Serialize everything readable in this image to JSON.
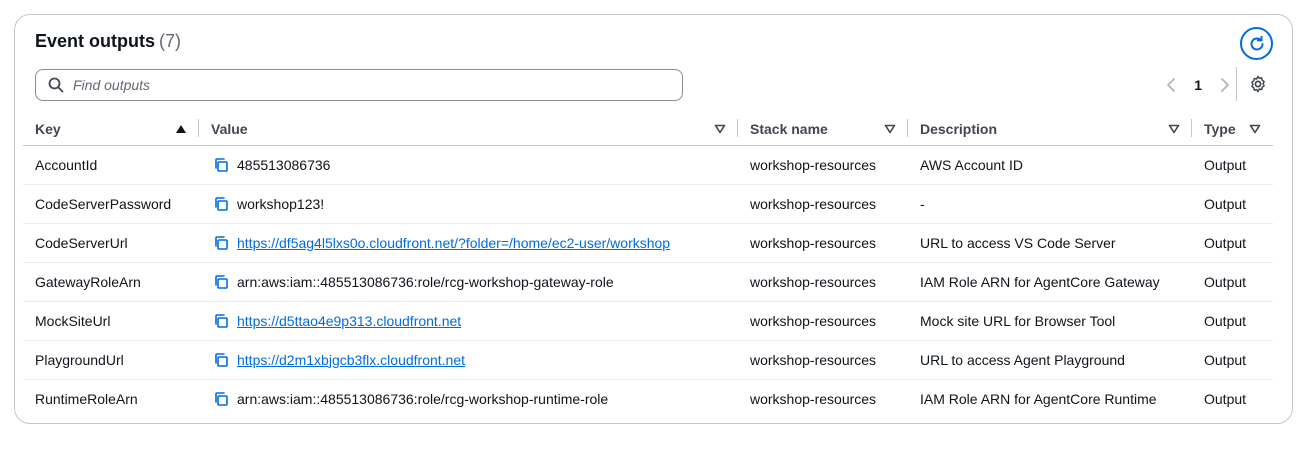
{
  "header": {
    "title": "Event outputs",
    "count": "(7)"
  },
  "search": {
    "placeholder": "Find outputs",
    "value": ""
  },
  "pagination": {
    "current_page": "1"
  },
  "columns": {
    "key": "Key",
    "value": "Value",
    "stack": "Stack name",
    "description": "Description",
    "type": "Type"
  },
  "rows": [
    {
      "key": "AccountId",
      "value": "485513086736",
      "is_link": false,
      "stack": "workshop-resources",
      "description": "AWS Account ID",
      "type": "Output"
    },
    {
      "key": "CodeServerPassword",
      "value": "workshop123!",
      "is_link": false,
      "stack": "workshop-resources",
      "description": "-",
      "type": "Output"
    },
    {
      "key": "CodeServerUrl",
      "value": "https://df5ag4l5lxs0o.cloudfront.net/?folder=/home/ec2-user/workshop",
      "is_link": true,
      "stack": "workshop-resources",
      "description": "URL to access VS Code Server",
      "type": "Output"
    },
    {
      "key": "GatewayRoleArn",
      "value": "arn:aws:iam::485513086736:role/rcg-workshop-gateway-role",
      "is_link": false,
      "stack": "workshop-resources",
      "description": "IAM Role ARN for AgentCore Gateway",
      "type": "Output"
    },
    {
      "key": "MockSiteUrl",
      "value": "https://d5ttao4e9p313.cloudfront.net",
      "is_link": true,
      "stack": "workshop-resources",
      "description": "Mock site URL for Browser Tool",
      "type": "Output"
    },
    {
      "key": "PlaygroundUrl",
      "value": "https://d2m1xbjgcb3flx.cloudfront.net",
      "is_link": true,
      "stack": "workshop-resources",
      "description": "URL to access Agent Playground",
      "type": "Output"
    },
    {
      "key": "RuntimeRoleArn",
      "value": "arn:aws:iam::485513086736:role/rcg-workshop-runtime-role",
      "is_link": false,
      "stack": "workshop-resources",
      "description": "IAM Role ARN for AgentCore Runtime",
      "type": "Output"
    }
  ],
  "icons": {
    "refresh": "refresh-icon",
    "search": "search-icon",
    "prev": "chevron-left-icon",
    "next": "chevron-right-icon",
    "settings": "gear-icon",
    "sort_asc": "sort-ascending-icon",
    "sort": "sort-descending-icon",
    "copy": "copy-icon"
  },
  "colors": {
    "link": "#006ce0",
    "accent": "#006ce0",
    "text": "#0f141a",
    "muted": "#656871",
    "border": "#c6c6cd"
  }
}
